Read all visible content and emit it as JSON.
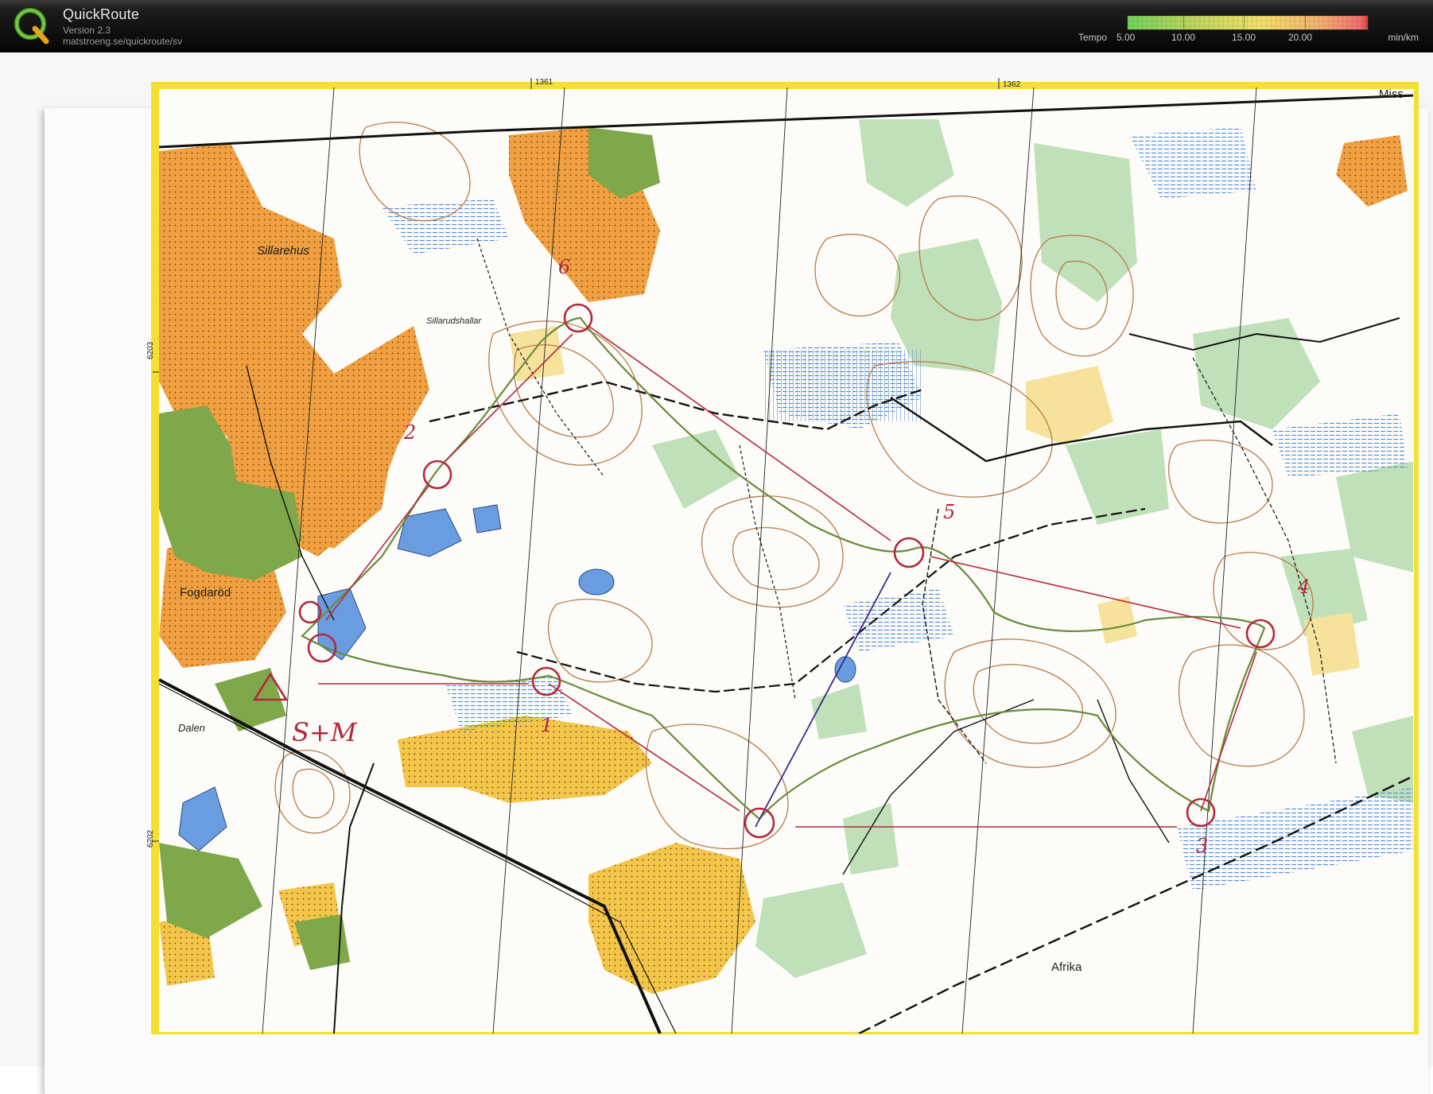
{
  "header": {
    "app_name": "QuickRoute",
    "version": "Version 2.3",
    "url": "matstroeng.se/quickroute/sv",
    "logo_letter": "Q",
    "tempo_label": "Tempo",
    "tempo_unit": "min/km",
    "tempo_ticks": [
      "5.00",
      "10.00",
      "15.00",
      "20.00"
    ]
  },
  "map": {
    "place_names": {
      "sillarehus": "Sillarehus",
      "sillarudshallar": "Sillarudshallar",
      "fogdarod": "Fogdaröd",
      "dalen": "Dalen",
      "afrika": "Afrika",
      "miss": "Miss"
    },
    "grid_labels": {
      "g1361": "1361",
      "g1362": "1362",
      "g6203": "6203",
      "g6202": "6202"
    },
    "start_annotation": "S+M",
    "control_numbers": [
      "1",
      "2",
      "3",
      "4",
      "5",
      "6"
    ]
  },
  "colors": {
    "accent_route": "#b4283c",
    "gps_track": "#6a8a3a",
    "open_land": "#f0a04a",
    "forest_green": "#8ab55c",
    "water": "#6a9de0",
    "contour": "#b87a4a",
    "frame_yellow": "#f4e030"
  }
}
